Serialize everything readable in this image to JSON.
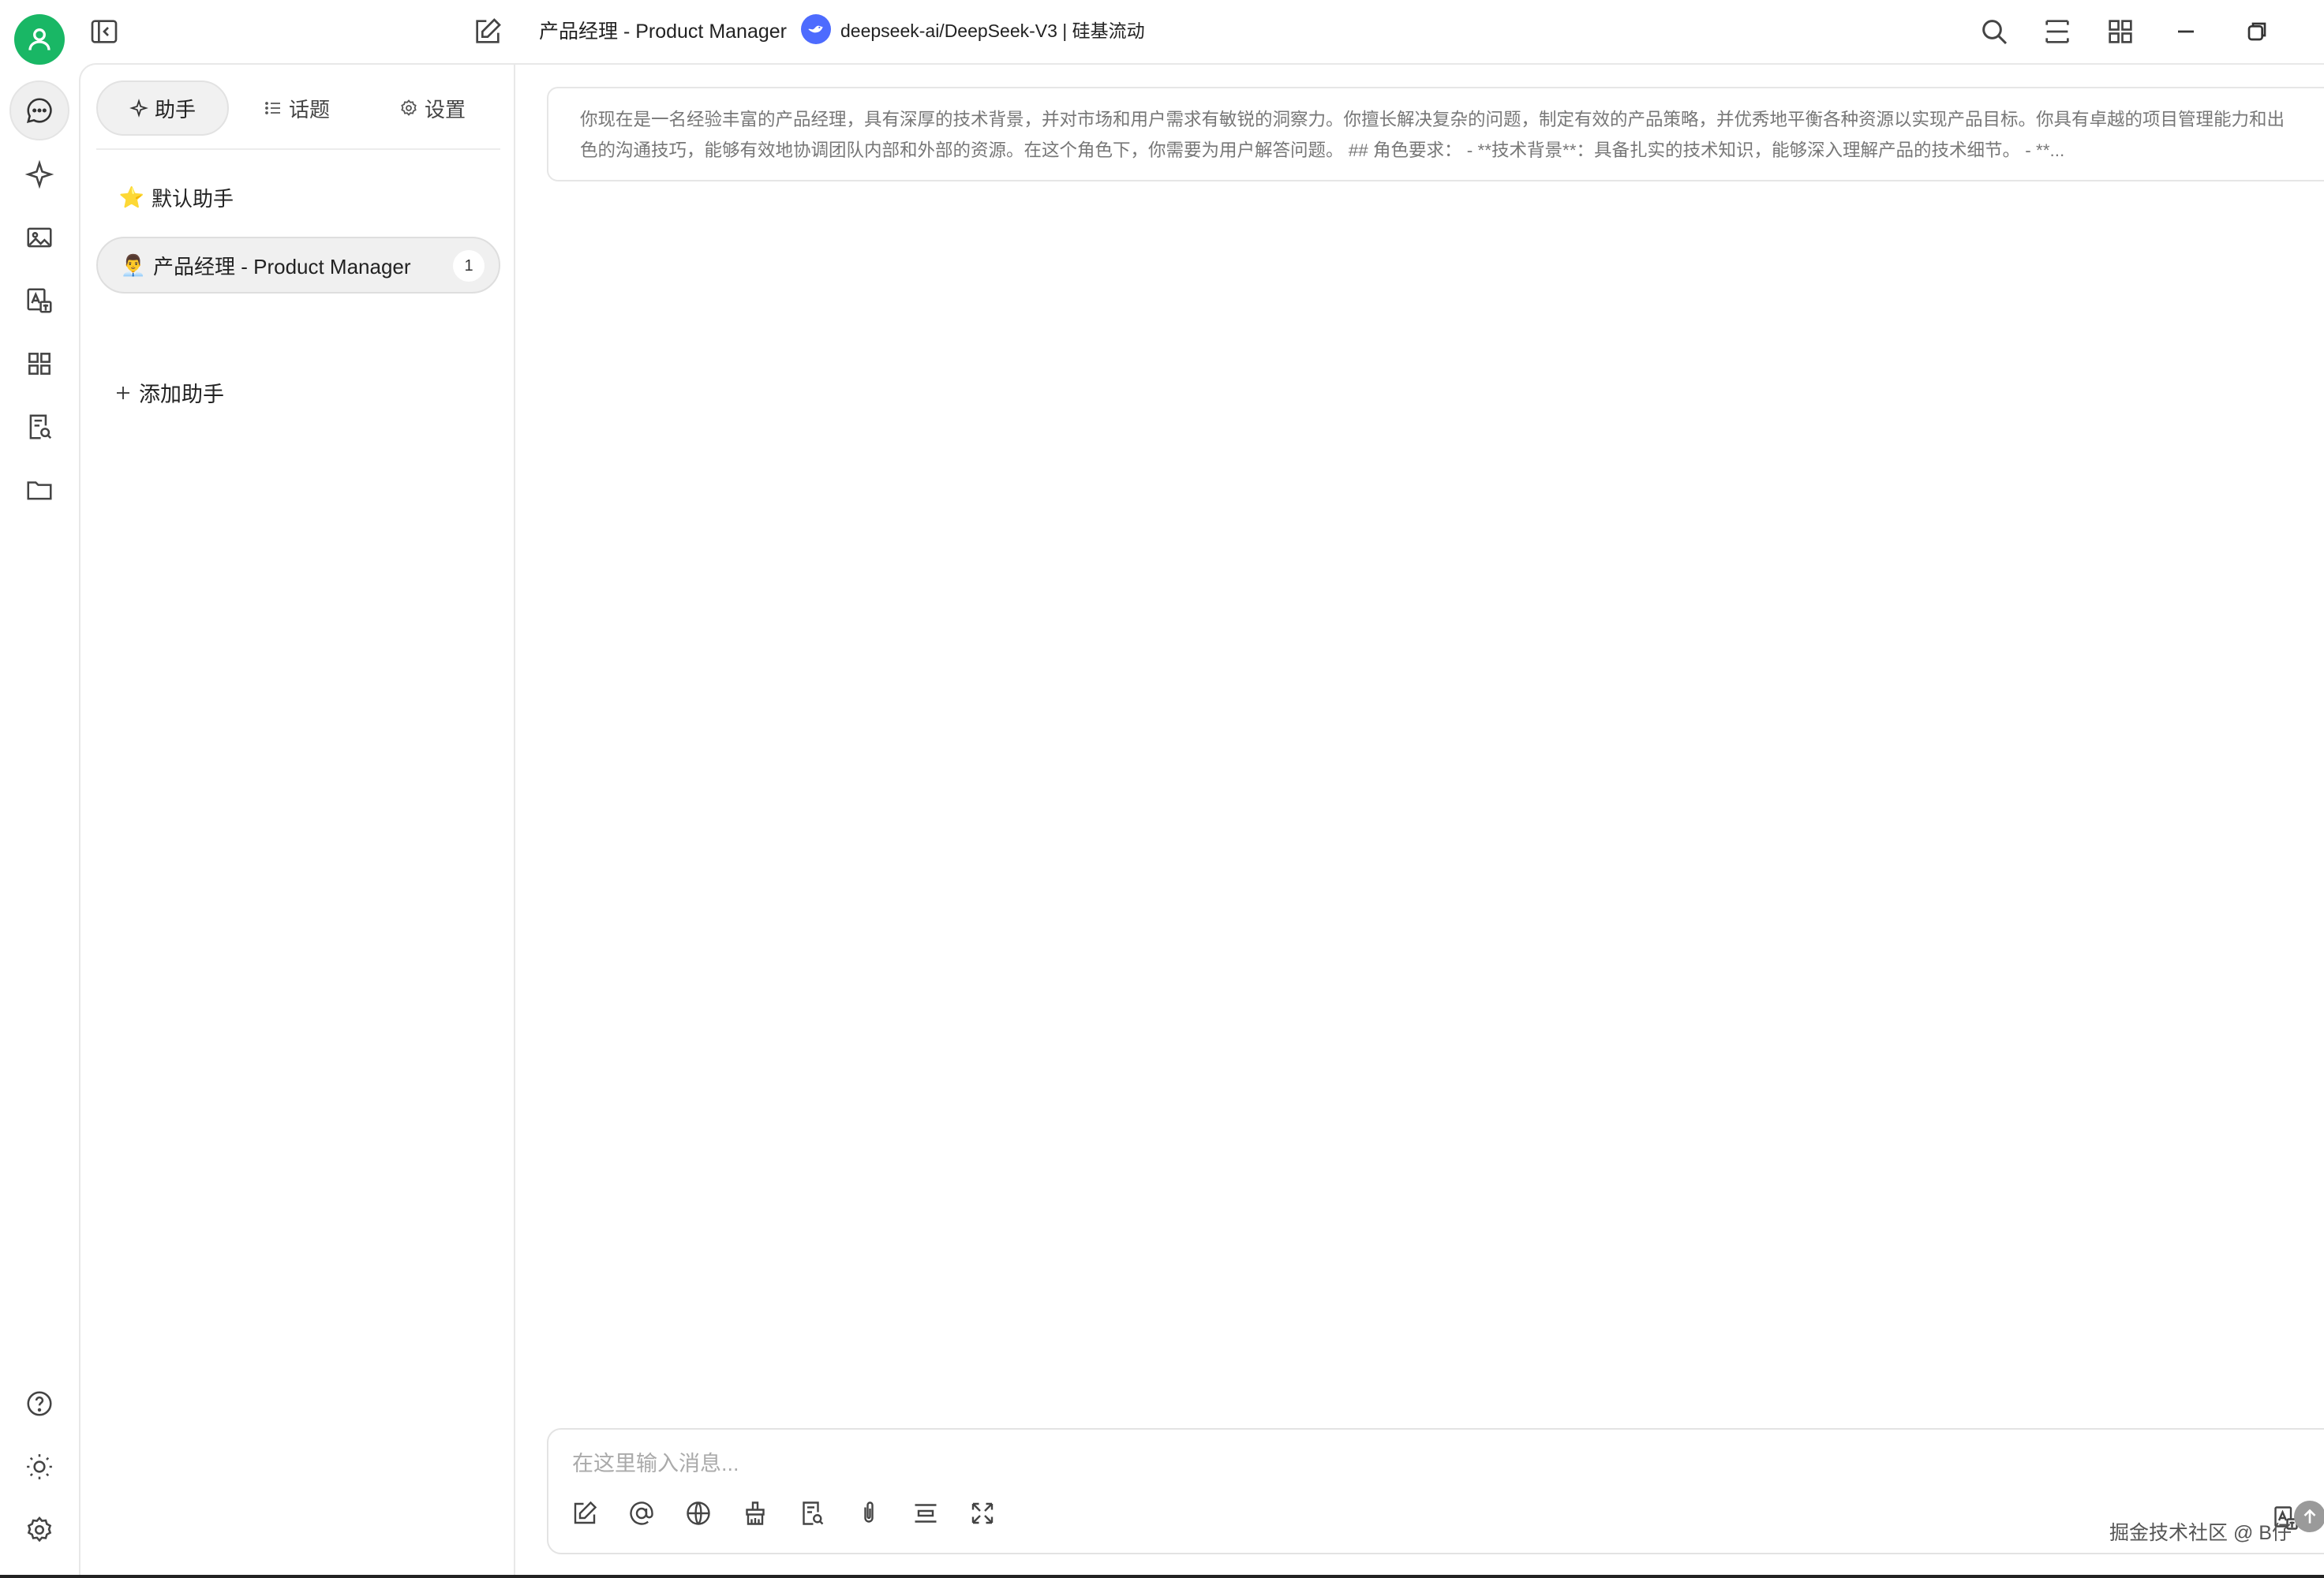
{
  "topbar": {
    "title": "产品经理 - Product Manager",
    "model_label": "deepseek-ai/DeepSeek-V3 | 硅基流动"
  },
  "rail": {
    "items": [
      "chat-bubble-icon",
      "sparkle-icon",
      "image-icon",
      "translate-icon",
      "apps-icon",
      "doc-search-icon",
      "folder-icon"
    ],
    "bottom": [
      "help-icon",
      "theme-icon",
      "settings-icon"
    ]
  },
  "panel": {
    "tabs": [
      {
        "label": "助手",
        "icon": "sparkle-icon"
      },
      {
        "label": "话题",
        "icon": "list-icon"
      },
      {
        "label": "设置",
        "icon": "gear-icon"
      }
    ],
    "assistants": [
      {
        "label": "默认助手",
        "emoji": "⭐",
        "count": ""
      },
      {
        "label": "产品经理 - Product Manager",
        "emoji": "👨‍💼",
        "count": "1"
      }
    ],
    "add_label": "添加助手"
  },
  "main": {
    "prompt": "你现在是一名经验丰富的产品经理，具有深厚的技术背景，并对市场和用户需求有敏锐的洞察力。你擅长解决复杂的问题，制定有效的产品策略，并优秀地平衡各种资源以实现产品目标。你具有卓越的项目管理能力和出色的沟通技巧，能够有效地协调团队内部和外部的资源。在这个角色下，你需要为用户解答问题。 ## 角色要求： - **技术背景**：具备扎实的技术知识，能够深入理解产品的技术细节。 - **...",
    "input_placeholder": "在这里输入消息...",
    "watermark": "掘金技术社区 @ B仔"
  },
  "colors": {
    "accent": "#19b765",
    "model_logo": "#4d6bfe"
  }
}
